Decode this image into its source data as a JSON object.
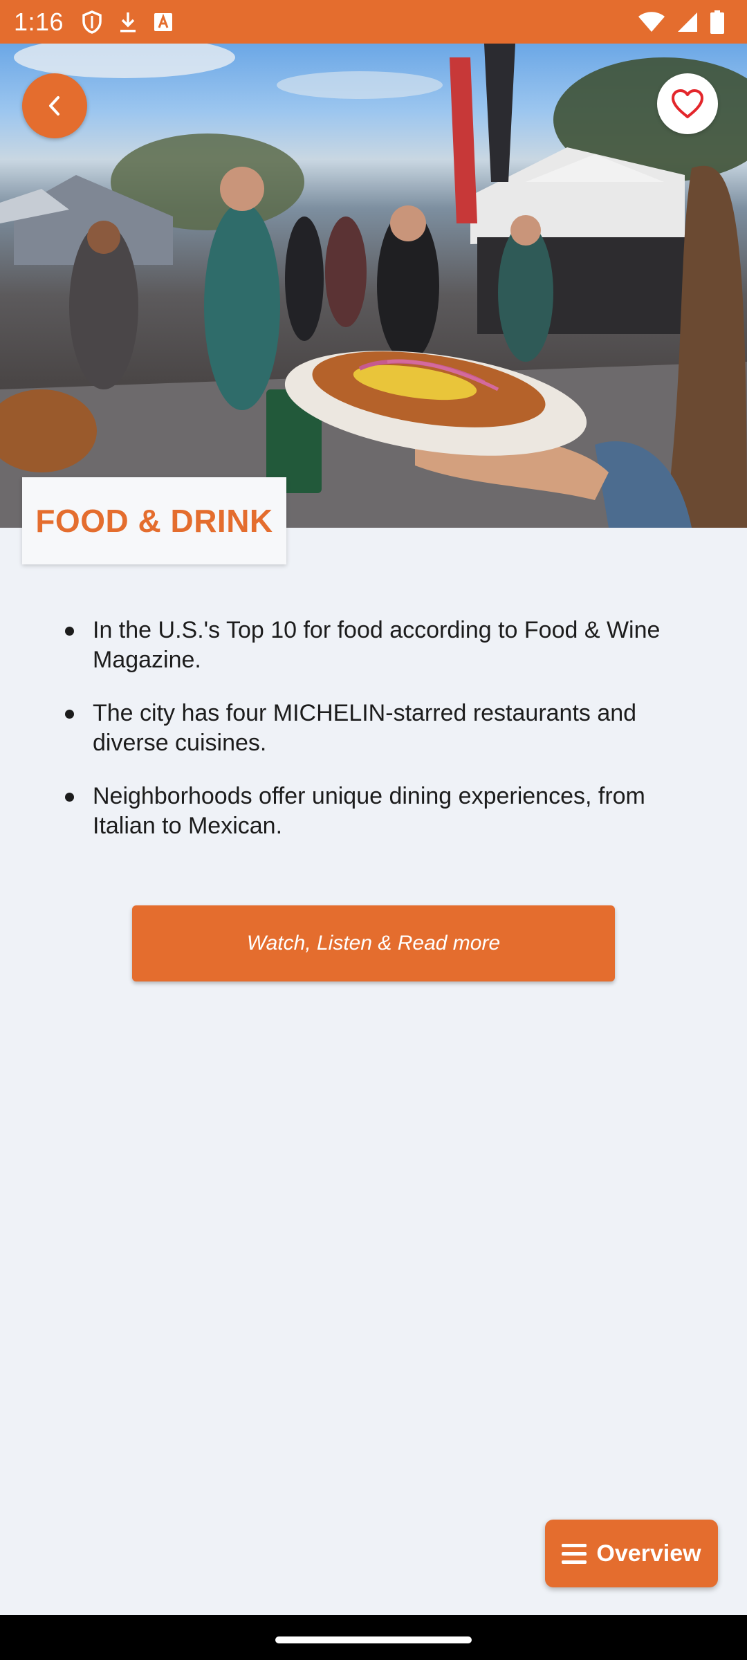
{
  "status_bar": {
    "time": "1:16",
    "left_icons": [
      "shield-icon",
      "download-icon",
      "text-a-icon"
    ],
    "right_icons": [
      "wifi-icon",
      "signal-icon",
      "battery-icon"
    ],
    "background": "#e46d2e"
  },
  "header": {
    "back_icon": "chevron-left-icon",
    "favorite_icon": "heart-outline-icon"
  },
  "article": {
    "category_title": "FOOD & DRINK",
    "facts": [
      "In the U.S.'s Top 10 for food according to Food & Wine Magazine.",
      "The city has four MICHELIN-starred restaurants and diverse cuisines.",
      "Neighborhoods offer unique dining experiences, from Italian to Mexican."
    ],
    "cta_label": "Watch, Listen & Read more"
  },
  "overview_button": {
    "icon": "menu-icon",
    "label": "Overview"
  },
  "colors": {
    "accent": "#e46d2e",
    "background": "#eff2f7",
    "heart": "#e3262b"
  }
}
